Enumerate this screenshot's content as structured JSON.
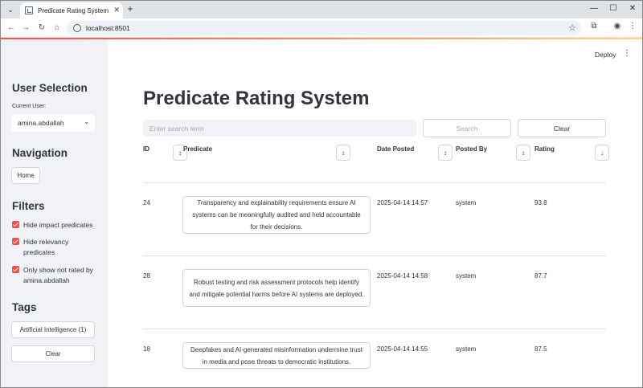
{
  "browser": {
    "tab_title": "Predicate Rating System",
    "url": "localhost:8501"
  },
  "sidebar": {
    "user_selection_heading": "User Selection",
    "current_user_label": "Current User:",
    "current_user_value": "amina.abdallah",
    "navigation_heading": "Navigation",
    "home_label": "Home",
    "filters_heading": "Filters",
    "filters": [
      {
        "label": "Hide impact predicates",
        "checked": true
      },
      {
        "label": "Hide relevancy predicates",
        "checked": true
      },
      {
        "label": "Only show not rated by amina.abdallah",
        "checked": true
      }
    ],
    "tags_heading": "Tags",
    "tags": [
      {
        "label": "Artificial Intelligence (1)"
      }
    ],
    "clear_label": "Clear"
  },
  "header": {
    "deploy_label": "Deploy"
  },
  "main": {
    "title": "Predicate Rating System",
    "search_placeholder": "Enter search term",
    "search_label": "Search",
    "clear_label": "Clear",
    "columns": [
      "ID",
      "Predicate",
      "Date Posted",
      "Posted By",
      "Rating"
    ],
    "rows": [
      {
        "id": "24",
        "predicate": "Transparency and explainability requirements ensure AI systems can be meaningfully audited and held accountable for their decisions.",
        "date": "2025-04-14 14:57",
        "posted_by": "system",
        "rating": "93.8"
      },
      {
        "id": "28",
        "predicate": "Robust testing and risk assessment protocols help identify and mitigate potential harms before AI systems are deployed.",
        "date": "2025-04-14 14:58",
        "posted_by": "system",
        "rating": "87.7"
      },
      {
        "id": "18",
        "predicate": "Deepfakes and AI-generated misinformation undermine trust in media and pose threats to democratic institutions.",
        "date": "2025-04-14 14:55",
        "posted_by": "system",
        "rating": "87.5"
      }
    ]
  },
  "colors": {
    "accent": "#ff4b4b",
    "sidebar_bg": "#f0f2f6",
    "text": "#31333f"
  },
  "icons": {
    "tab_list": "chevron-down-icon",
    "favicon": "chart-icon",
    "tab_close": "close-icon",
    "new_tab": "plus-icon",
    "back": "arrow-left-icon",
    "forward": "arrow-right-icon",
    "reload": "reload-icon",
    "home": "home-icon",
    "site_info": "info-icon",
    "bookmark": "star-icon",
    "extensions": "puzzle-icon",
    "profile": "profile-icon",
    "menu": "kebab-icon",
    "sort_both": "sort-both-icon",
    "sort_desc": "sort-down-icon"
  }
}
